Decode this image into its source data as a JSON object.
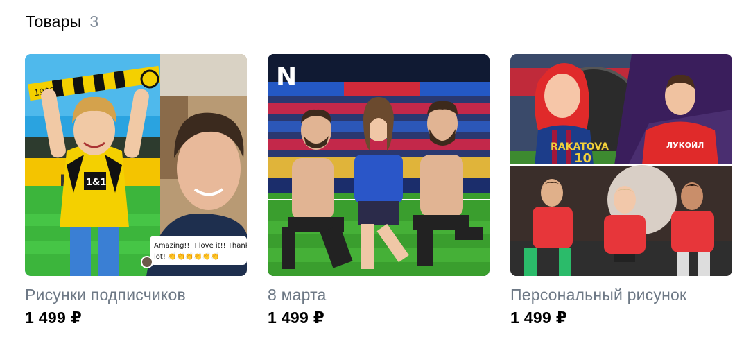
{
  "section": {
    "title": "Товары",
    "count": "3"
  },
  "products": [
    {
      "name": "Рисунки подписчиков",
      "price": "1 499 ₽",
      "image": {
        "caption_line1": "Amazing!!! I love it!! Thanks a",
        "caption_line2": "lot! 👏👏👏👏👏👏",
        "scarf_text": "1909",
        "shirt_text": "1&1"
      }
    },
    {
      "name": "8 марта",
      "price": "1 499 ₽",
      "image": {
        "logo_text": "N"
      }
    },
    {
      "name": "Персональный рисунок",
      "price": "1 499 ₽",
      "image": {
        "shirt_text_1": "RAKATOVA",
        "shirt_number": "10",
        "shirt_text_2": "ЛУКОЙЛ"
      }
    }
  ]
}
